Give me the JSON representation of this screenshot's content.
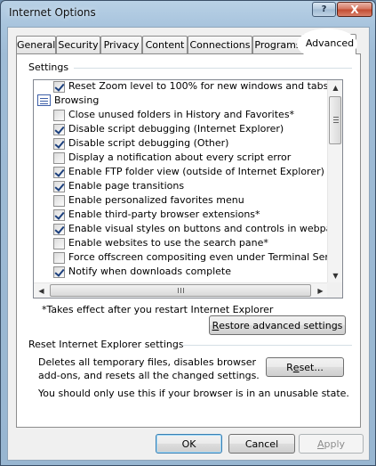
{
  "window": {
    "title": "Internet Options",
    "help_glyph": "?",
    "close_glyph": "X"
  },
  "tabs": [
    {
      "label": "General",
      "active": false
    },
    {
      "label": "Security",
      "active": false
    },
    {
      "label": "Privacy",
      "active": false
    },
    {
      "label": "Content",
      "active": false
    },
    {
      "label": "Connections",
      "active": false
    },
    {
      "label": "Programs",
      "active": false
    },
    {
      "label": "Advanced",
      "active": true
    }
  ],
  "settings": {
    "group_label": "Settings",
    "items": [
      {
        "text": "Reset Zoom level to 100% for new windows and tabs",
        "checked": true
      },
      {
        "text": "Browsing",
        "category": true
      },
      {
        "text": "Close unused folders in History and Favorites*",
        "checked": false
      },
      {
        "text": "Disable script debugging (Internet Explorer)",
        "checked": true
      },
      {
        "text": "Disable script debugging (Other)",
        "checked": true
      },
      {
        "text": "Display a notification about every script error",
        "checked": false
      },
      {
        "text": "Enable FTP folder view (outside of Internet Explorer)",
        "checked": true
      },
      {
        "text": "Enable page transitions",
        "checked": true
      },
      {
        "text": "Enable personalized favorites menu",
        "checked": false
      },
      {
        "text": "Enable third-party browser extensions*",
        "checked": true
      },
      {
        "text": "Enable visual styles on buttons and controls in webpages",
        "checked": true
      },
      {
        "text": "Enable websites to use the search pane*",
        "checked": false
      },
      {
        "text": "Force offscreen compositing even under Terminal Server*",
        "checked": false
      },
      {
        "text": "Notify when downloads complete",
        "checked": true
      }
    ],
    "note": "*Takes effect after you restart Internet Explorer",
    "restore_button": {
      "pre": "",
      "accel": "R",
      "post": "estore advanced settings"
    }
  },
  "reset": {
    "group_label": "Reset Internet Explorer settings",
    "description_line1": "Deletes all temporary files, disables browser",
    "description_line2": "add-ons, and resets all the changed settings.",
    "warning": "You should only use this if your browser is in an unusable state.",
    "reset_button": {
      "pre": "R",
      "accel": "e",
      "post": "set..."
    }
  },
  "footer": {
    "ok_label": "OK",
    "cancel_button": {
      "pre": "Cancel",
      "accel": "",
      "post": ""
    },
    "apply_button": {
      "pre": "",
      "accel": "A",
      "post": "pply"
    }
  },
  "icons": {
    "up_arrow": "▲",
    "down_arrow": "▼",
    "left_arrow": "◀",
    "right_arrow": "▶"
  }
}
